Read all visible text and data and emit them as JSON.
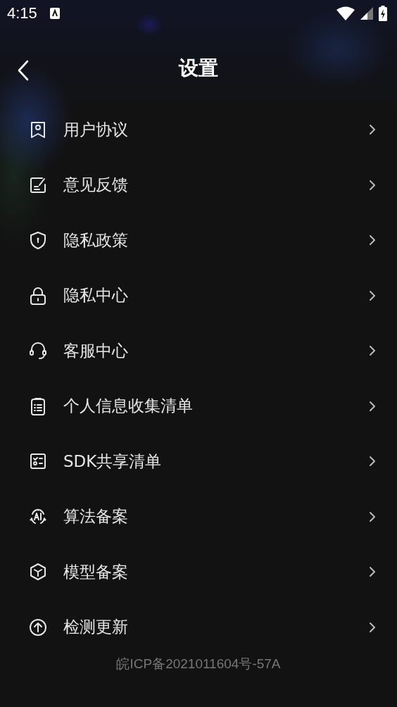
{
  "status_bar": {
    "time": "4:15"
  },
  "header": {
    "title": "设置"
  },
  "items": [
    {
      "label": "用户协议"
    },
    {
      "label": "意见反馈"
    },
    {
      "label": "隐私政策"
    },
    {
      "label": "隐私中心"
    },
    {
      "label": "客服中心"
    },
    {
      "label": "个人信息收集清单"
    },
    {
      "label": "SDK共享清单"
    },
    {
      "label": "算法备案"
    },
    {
      "label": "模型备案"
    },
    {
      "label": "检测更新"
    }
  ],
  "footer": {
    "text": "皖ICP备2021011604号-57A"
  }
}
